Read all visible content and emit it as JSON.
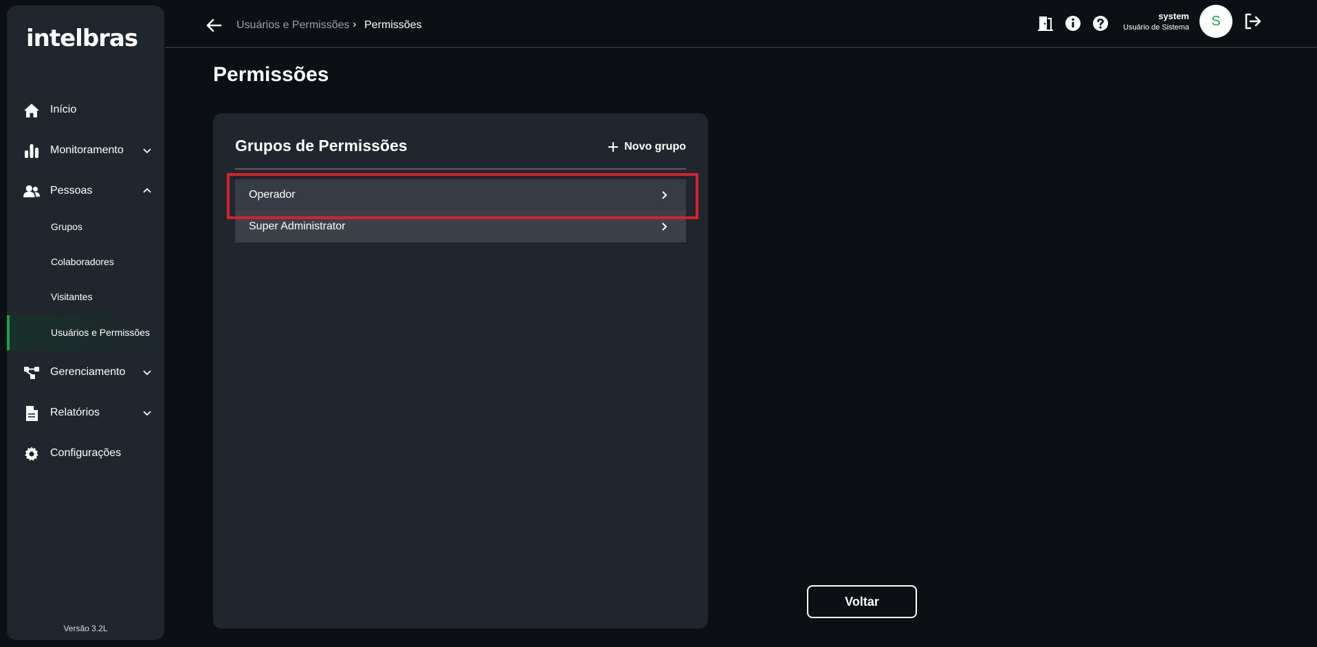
{
  "brand": {
    "logo_text": "intelbras",
    "accent": "#1aa14a"
  },
  "sidebar": {
    "items": [
      {
        "label": "Início",
        "icon": "home-icon"
      },
      {
        "label": "Monitoramento",
        "icon": "bar-chart-icon",
        "expandable": true
      },
      {
        "label": "Pessoas",
        "icon": "people-icon",
        "expanded": true
      },
      {
        "label": "Gerenciamento",
        "icon": "network-icon",
        "expandable": true
      },
      {
        "label": "Relatórios",
        "icon": "document-icon",
        "expandable": true
      },
      {
        "label": "Configurações",
        "icon": "gear-icon"
      }
    ],
    "subitems": [
      {
        "label": "Grupos"
      },
      {
        "label": "Colaboradores"
      },
      {
        "label": "Visitantes"
      },
      {
        "label": "Usuários e Permissões",
        "active": true
      }
    ],
    "version": "Versão 3.2L"
  },
  "header": {
    "breadcrumb_parent": "Usuários e Permissões",
    "breadcrumb_sep": "›",
    "breadcrumb_current": "Permissões",
    "user_name": "system",
    "user_role": "Usuário de Sistema",
    "avatar_initial": "S"
  },
  "page": {
    "title": "Permissões"
  },
  "panel": {
    "title": "Grupos de Permissões",
    "new_group_label": "Novo grupo",
    "groups": [
      {
        "label": "Operador"
      },
      {
        "label": "Super Administrator"
      }
    ]
  },
  "footer": {
    "back_button": "Voltar"
  }
}
